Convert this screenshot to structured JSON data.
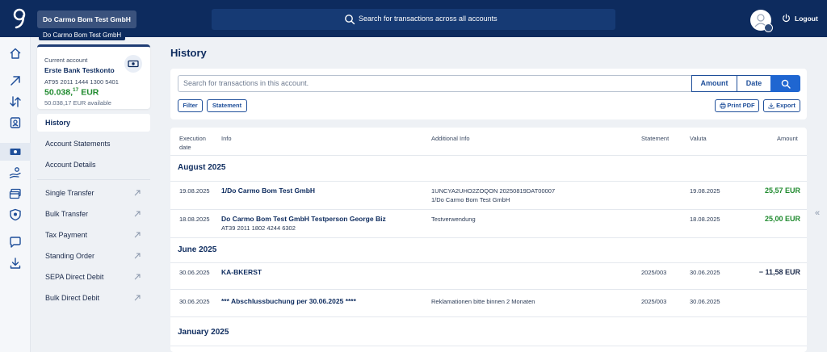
{
  "topbar": {
    "company": "Do Carmo Bom Test GmbH",
    "company_tooltip": "Do Carmo Bom Test GmbH",
    "search_placeholder": "Search for transactions across all accounts",
    "logout_label": "Logout"
  },
  "account": {
    "label": "Current account",
    "name": "Erste Bank Testkonto",
    "iban": "AT95 2011 1444 1300 5401",
    "balance_main": "50.038,",
    "balance_cents": "17",
    "balance_currency": " EUR",
    "available": "50.038,17 EUR available"
  },
  "nav": {
    "history": "History",
    "statements": "Account Statements",
    "details": "Account Details",
    "single_transfer": "Single Transfer",
    "bulk_transfer": "Bulk Transfer",
    "tax_payment": "Tax Payment",
    "standing_order": "Standing Order",
    "sepa_direct_debit": "SEPA Direct Debit",
    "bulk_direct_debit": "Bulk Direct Debit"
  },
  "main": {
    "title": "History",
    "search_placeholder": "Search for transactions in this account.",
    "amount_button": "Amount",
    "date_button": "Date",
    "filter_label": "Filter",
    "statement_label": "Statement",
    "print_label": "Print PDF",
    "export_label": "Export"
  },
  "table": {
    "headers": {
      "execution_date_1": "Execution",
      "execution_date_2": "date",
      "info": "Info",
      "additional_info": "Additional Info",
      "statement": "Statement",
      "valuta": "Valuta",
      "amount": "Amount"
    },
    "groups": {
      "aug": "August 2025",
      "jun": "June 2025",
      "jan": "January 2025"
    },
    "rows": [
      {
        "date": "19.08.2025",
        "info": "1/Do Carmo Bom Test GmbH",
        "info_sub": "",
        "additional_1": "1UNCYA2UHO2ZOQON 20250819DAT00007",
        "additional_2": "1/Do Carmo Bom Test GmbH",
        "statement": "",
        "valuta": "19.08.2025",
        "amount": "25,57 EUR"
      },
      {
        "date": "18.08.2025",
        "info": "Do Carmo Bom Test GmbH Testperson George Biz",
        "info_sub": "AT39 2011 1802 4244 6302",
        "additional_1": "Testverwendung",
        "additional_2": "",
        "statement": "",
        "valuta": "18.08.2025",
        "amount": "25,00 EUR"
      },
      {
        "date": "30.06.2025",
        "info": "KA-BKERST",
        "info_sub": "",
        "additional_1": "",
        "additional_2": "",
        "statement": "2025/003",
        "valuta": "30.06.2025",
        "amount": "− 11,58 EUR"
      },
      {
        "date": "30.06.2025",
        "info": "*** Abschlussbuchung per 30.06.2025 ****",
        "info_sub": "",
        "additional_1": "Reklamationen bitte binnen 2 Monaten",
        "additional_2": "",
        "statement": "2025/003",
        "valuta": "30.06.2025",
        "amount": ""
      }
    ]
  },
  "colors": {
    "navy": "#0d2b5e",
    "accent": "#1f66d1",
    "positive": "#1f8a2e"
  }
}
